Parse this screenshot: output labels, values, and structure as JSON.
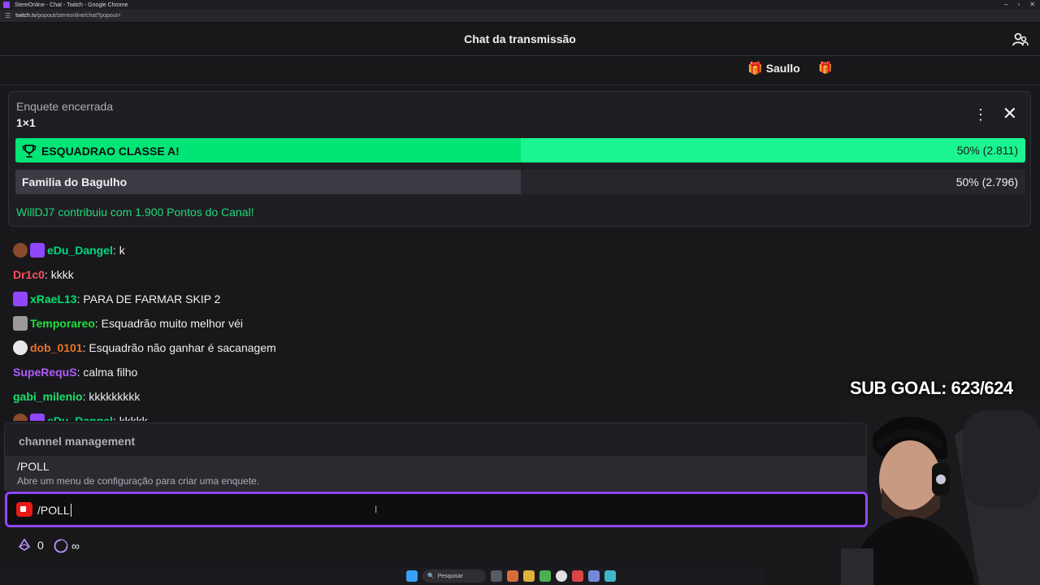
{
  "browser": {
    "window_title": "StereOnline - Chat - Twitch - Google Chrome",
    "url_domain": "twitch.tv",
    "url_path": "/popout/stereonline/chat?popout="
  },
  "header": {
    "title": "Chat da transmissão"
  },
  "gift_bar": {
    "username": "Saullo"
  },
  "poll": {
    "status": "Enquete encerrada",
    "title": "1×1",
    "options": [
      {
        "label": "ESQUADRAO CLASSE A!",
        "result": "50% (2.811)",
        "fraction": 0.5,
        "winner": true
      },
      {
        "label": "Familia do Bagulho",
        "result": "50% (2.796)",
        "fraction": 0.5,
        "winner": false
      }
    ],
    "contribution": "WillDJ7 contribuiu com 1.900 Pontos do Canal!"
  },
  "messages": [
    {
      "user": "eDu_Dangel",
      "text": "k",
      "color": "#00d97e"
    },
    {
      "user": "Dr1c0",
      "text": "kkkk",
      "color": "#ff4f5e"
    },
    {
      "user": "xRaeL13",
      "text": "PARA DE FARMAR SKIP 2",
      "color": "#00e36b"
    },
    {
      "user": "Temporareo",
      "text": "Esquadrão muito melhor véi",
      "color": "#1fe03a"
    },
    {
      "user": "dob_0101",
      "text": "Esquadrão não ganhar é sacanagem",
      "color": "#e8742a"
    },
    {
      "user": "SupeRequS",
      "text": "calma filho",
      "color": "#b05cff"
    },
    {
      "user": "gabi_milenio",
      "text": "kkkkkkkkk",
      "color": "#1fe06a"
    },
    {
      "user": "eDu_Dangel",
      "text": "kkkkk",
      "color": "#00d97e"
    }
  ],
  "overlay": {
    "sub_goal": "SUB GOAL: 623/624"
  },
  "suggestions": {
    "group": "channel management",
    "command": "/POLL",
    "description": "Abre um menu de configuração para criar uma enquete."
  },
  "input": {
    "value": "/POLL"
  },
  "bottom": {
    "bits": "0",
    "points": "∞"
  },
  "taskbar": {
    "search_placeholder": "Pesquisar"
  },
  "colors": {
    "accent": "#9146ff",
    "winner": "#00f593",
    "background": "#18181b"
  }
}
